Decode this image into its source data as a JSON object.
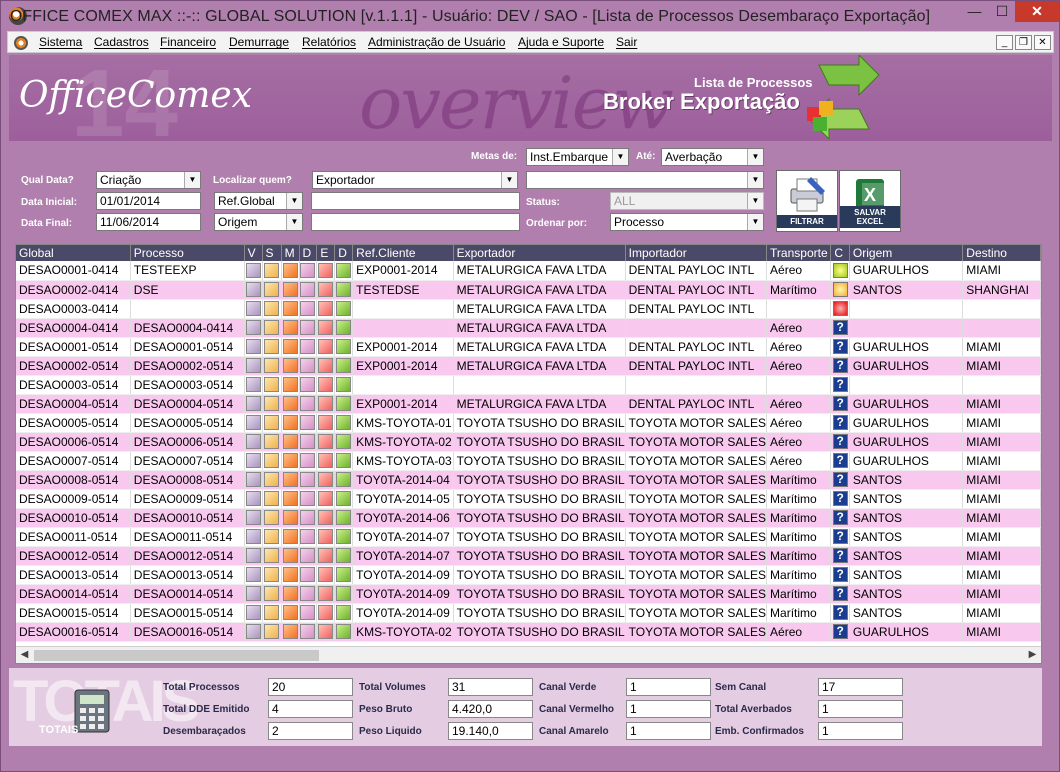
{
  "window": {
    "title": "OFFICE COMEX MAX ::-:: GLOBAL SOLUTION [v.1.1.1] - Usuário: DEV / SAO - [Lista de Processos Desembaraço Exportação]",
    "minimize": "—",
    "maximize": "☐",
    "close": "✕"
  },
  "menu": [
    "Sistema",
    "Cadastros",
    "Financeiro",
    "Demurrage",
    "Relatórios",
    "Administração de Usuário",
    "Ajuda e Suporte",
    "Sair"
  ],
  "banner": {
    "logo": "OfficeComex",
    "ghost": "14",
    "overview": "overview",
    "sub1": "Lista de Processos",
    "sub2": "Broker Exportação"
  },
  "filters": {
    "metas_label": "Metas de:",
    "metas_value": "Inst.Embarque",
    "ate_label": "Até:",
    "ate_value": "Averbação",
    "qual_data_label": "Qual Data?",
    "qual_data_value": "Criação",
    "localizar_label": "Localizar quem?",
    "localizar_value": "Exportador",
    "localizar_text": "",
    "data_inicial_label": "Data Inicial:",
    "data_inicial_value": "01/01/2014",
    "ref_select": "Ref.Global",
    "ref_text": "",
    "status_label": "Status:",
    "status_value": "ALL",
    "data_final_label": "Data Final:",
    "data_final_value": "11/06/2014",
    "origem_select": "Origem",
    "origem_text": "",
    "ordenar_label": "Ordenar por:",
    "ordenar_value": "Processo",
    "filtrar_label": "FILTRAR",
    "salvar_label": "SALVAR EXCEL"
  },
  "grid": {
    "columns": [
      "Global",
      "Processo",
      "V",
      "S",
      "M",
      "D",
      "E",
      "D",
      "Ref.Cliente",
      "Exportador",
      "Importador",
      "Transporte",
      "C",
      "Origem",
      "Destino"
    ],
    "rows": [
      {
        "global": "DESAO0001-0414",
        "processo": "TESTEEXP",
        "ref": "EXP0001-2014",
        "exp": "METALURGICA FAVA LTDA",
        "imp": "DENTAL PAYLOC INTL",
        "trans": "Aéreo",
        "c": "g",
        "origem": "GUARULHOS",
        "destino": "MIAMI"
      },
      {
        "global": "DESAO0002-0414",
        "processo": "DSE",
        "ref": "TESTEDSE",
        "exp": "METALURGICA FAVA LTDA",
        "imp": "DENTAL PAYLOC INTL",
        "trans": "Marítimo",
        "c": "y",
        "origem": "SANTOS",
        "destino": "SHANGHAI"
      },
      {
        "global": "DESAO0003-0414",
        "processo": "",
        "ref": "",
        "exp": "METALURGICA FAVA LTDA",
        "imp": "DENTAL PAYLOC INTL",
        "trans": "",
        "c": "r",
        "origem": "",
        "destino": ""
      },
      {
        "global": "DESAO0004-0414",
        "processo": "DESAO0004-0414",
        "ref": "",
        "exp": "METALURGICA FAVA LTDA",
        "imp": "",
        "trans": "Aéreo",
        "c": "q",
        "origem": "",
        "destino": ""
      },
      {
        "global": "DESAO0001-0514",
        "processo": "DESAO0001-0514",
        "ref": "EXP0001-2014",
        "exp": "METALURGICA FAVA LTDA",
        "imp": "DENTAL PAYLOC INTL",
        "trans": "Aéreo",
        "c": "q",
        "origem": "GUARULHOS",
        "destino": "MIAMI"
      },
      {
        "global": "DESAO0002-0514",
        "processo": "DESAO0002-0514",
        "ref": "EXP0001-2014",
        "exp": "METALURGICA FAVA LTDA",
        "imp": "DENTAL PAYLOC INTL",
        "trans": "Aéreo",
        "c": "q",
        "origem": "GUARULHOS",
        "destino": "MIAMI"
      },
      {
        "global": "DESAO0003-0514",
        "processo": "DESAO0003-0514",
        "ref": "",
        "exp": "",
        "imp": "",
        "trans": "",
        "c": "q",
        "origem": "",
        "destino": ""
      },
      {
        "global": "DESAO0004-0514",
        "processo": "DESAO0004-0514",
        "ref": "EXP0001-2014",
        "exp": "METALURGICA FAVA LTDA",
        "imp": "DENTAL PAYLOC INTL",
        "trans": "Aéreo",
        "c": "q",
        "origem": "GUARULHOS",
        "destino": "MIAMI"
      },
      {
        "global": "DESAO0005-0514",
        "processo": "DESAO0005-0514",
        "ref": "KMS-TOYOTA-01",
        "exp": "TOYOTA TSUSHO DO BRASIL",
        "imp": "TOYOTA MOTOR SALES",
        "trans": "Aéreo",
        "c": "q",
        "origem": "GUARULHOS",
        "destino": "MIAMI"
      },
      {
        "global": "DESAO0006-0514",
        "processo": "DESAO0006-0514",
        "ref": "KMS-TOYOTA-02",
        "exp": "TOYOTA TSUSHO DO BRASIL",
        "imp": "TOYOTA MOTOR SALES",
        "trans": "Aéreo",
        "c": "q",
        "origem": "GUARULHOS",
        "destino": "MIAMI"
      },
      {
        "global": "DESAO0007-0514",
        "processo": "DESAO0007-0514",
        "ref": "KMS-TOYOTA-03",
        "exp": "TOYOTA TSUSHO DO BRASIL",
        "imp": "TOYOTA MOTOR SALES",
        "trans": "Aéreo",
        "c": "q",
        "origem": "GUARULHOS",
        "destino": "MIAMI"
      },
      {
        "global": "DESAO0008-0514",
        "processo": "DESAO0008-0514",
        "ref": "TOY0TA-2014-04",
        "exp": "TOYOTA TSUSHO DO BRASIL",
        "imp": "TOYOTA MOTOR SALES",
        "trans": "Marítimo",
        "c": "q",
        "origem": "SANTOS",
        "destino": "MIAMI"
      },
      {
        "global": "DESAO0009-0514",
        "processo": "DESAO0009-0514",
        "ref": "TOY0TA-2014-05",
        "exp": "TOYOTA TSUSHO DO BRASIL",
        "imp": "TOYOTA MOTOR SALES",
        "trans": "Marítimo",
        "c": "q",
        "origem": "SANTOS",
        "destino": "MIAMI"
      },
      {
        "global": "DESAO0010-0514",
        "processo": "DESAO0010-0514",
        "ref": "TOY0TA-2014-06",
        "exp": "TOYOTA TSUSHO DO BRASIL",
        "imp": "TOYOTA MOTOR SALES",
        "trans": "Marítimo",
        "c": "q",
        "origem": "SANTOS",
        "destino": "MIAMI"
      },
      {
        "global": "DESAO0011-0514",
        "processo": "DESAO0011-0514",
        "ref": "TOY0TA-2014-07",
        "exp": "TOYOTA TSUSHO DO BRASIL",
        "imp": "TOYOTA MOTOR SALES",
        "trans": "Marítimo",
        "c": "q",
        "origem": "SANTOS",
        "destino": "MIAMI"
      },
      {
        "global": "DESAO0012-0514",
        "processo": "DESAO0012-0514",
        "ref": "TOY0TA-2014-07",
        "exp": "TOYOTA TSUSHO DO BRASIL",
        "imp": "TOYOTA MOTOR SALES",
        "trans": "Marítimo",
        "c": "q",
        "origem": "SANTOS",
        "destino": "MIAMI"
      },
      {
        "global": "DESAO0013-0514",
        "processo": "DESAO0013-0514",
        "ref": "TOY0TA-2014-09",
        "exp": "TOYOTA TSUSHO DO BRASIL",
        "imp": "TOYOTA MOTOR SALES",
        "trans": "Marítimo",
        "c": "q",
        "origem": "SANTOS",
        "destino": "MIAMI"
      },
      {
        "global": "DESAO0014-0514",
        "processo": "DESAO0014-0514",
        "ref": "TOY0TA-2014-09",
        "exp": "TOYOTA TSUSHO DO BRASIL",
        "imp": "TOYOTA MOTOR SALES",
        "trans": "Marítimo",
        "c": "q",
        "origem": "SANTOS",
        "destino": "MIAMI"
      },
      {
        "global": "DESAO0015-0514",
        "processo": "DESAO0015-0514",
        "ref": "TOY0TA-2014-09",
        "exp": "TOYOTA TSUSHO DO BRASIL",
        "imp": "TOYOTA MOTOR SALES",
        "trans": "Marítimo",
        "c": "q",
        "origem": "SANTOS",
        "destino": "MIAMI"
      },
      {
        "global": "DESAO0016-0514",
        "processo": "DESAO0016-0514",
        "ref": "KMS-TOYOTA-02",
        "exp": "TOYOTA TSUSHO DO BRASIL",
        "imp": "TOYOTA MOTOR SALES",
        "trans": "Aéreo",
        "c": "q",
        "origem": "GUARULHOS",
        "destino": "MIAMI"
      }
    ]
  },
  "totals": {
    "watermark": "TOTAIS",
    "caption": "TOTAIS",
    "items": [
      {
        "label": "Total Processos",
        "value": "20"
      },
      {
        "label": "Total DDE Emitido",
        "value": "4"
      },
      {
        "label": "Desembaraçados",
        "value": "2"
      },
      {
        "label": "Total Volumes",
        "value": "31"
      },
      {
        "label": "Peso Bruto",
        "value": "4.420,0"
      },
      {
        "label": "Peso Liquido",
        "value": "19.140,0"
      },
      {
        "label": "Canal Verde",
        "value": "1"
      },
      {
        "label": "Canal Vermelho",
        "value": "1"
      },
      {
        "label": "Canal Amarelo",
        "value": "1"
      },
      {
        "label": "Sem Canal",
        "value": "17"
      },
      {
        "label": "Total Averbados",
        "value": "1"
      },
      {
        "label": "Emb. Confirmados",
        "value": "1"
      }
    ]
  }
}
